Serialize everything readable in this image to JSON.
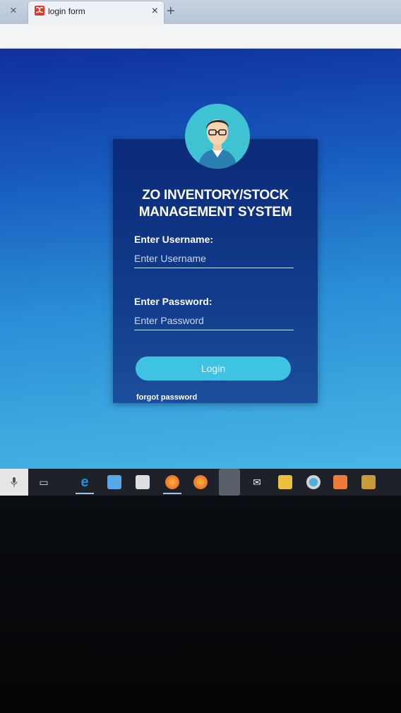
{
  "browser": {
    "tab_title": "login form",
    "tab_close": "×",
    "new_tab": "+",
    "inactive_tab_close": "×"
  },
  "card": {
    "title_line1": "ZO INVENTORY/STOCK",
    "title_line2": "MANAGEMENT SYSTEM",
    "username_label": "Enter Username:",
    "username_placeholder": "Enter Username",
    "password_label": "Enter Password:",
    "password_placeholder": "Enter Password",
    "login_label": "Login",
    "forgot_label": "forgot password"
  },
  "taskbar": {
    "icons": [
      "microphone-icon",
      "task-view-icon",
      "edge-icon",
      "file-explorer-icon",
      "store-icon",
      "firefox-icon",
      "firefox-icon",
      "opera-icon",
      "mail-icon",
      "sticky-notes-icon",
      "chrome-icon",
      "xampp-icon",
      "app-icon"
    ]
  },
  "colors": {
    "accent": "#3fc3e3",
    "card_bg": "#0b2a78",
    "page_bg": "#1759bd"
  }
}
